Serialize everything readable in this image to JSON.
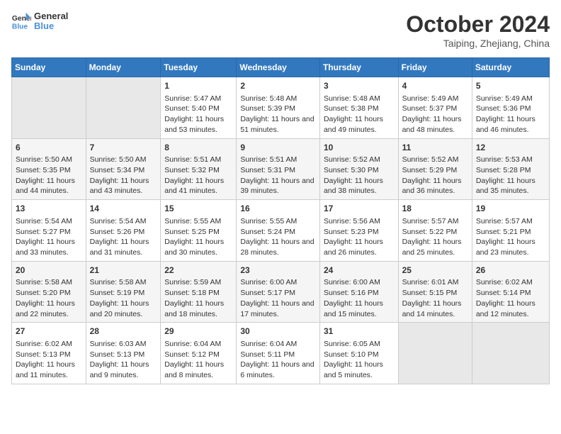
{
  "logo": {
    "line1": "General",
    "line2": "Blue"
  },
  "title": "October 2024",
  "location": "Taiping, Zhejiang, China",
  "days_of_week": [
    "Sunday",
    "Monday",
    "Tuesday",
    "Wednesday",
    "Thursday",
    "Friday",
    "Saturday"
  ],
  "weeks": [
    [
      {
        "day": "",
        "info": ""
      },
      {
        "day": "",
        "info": ""
      },
      {
        "day": "1",
        "info": "Sunrise: 5:47 AM\nSunset: 5:40 PM\nDaylight: 11 hours and 53 minutes."
      },
      {
        "day": "2",
        "info": "Sunrise: 5:48 AM\nSunset: 5:39 PM\nDaylight: 11 hours and 51 minutes."
      },
      {
        "day": "3",
        "info": "Sunrise: 5:48 AM\nSunset: 5:38 PM\nDaylight: 11 hours and 49 minutes."
      },
      {
        "day": "4",
        "info": "Sunrise: 5:49 AM\nSunset: 5:37 PM\nDaylight: 11 hours and 48 minutes."
      },
      {
        "day": "5",
        "info": "Sunrise: 5:49 AM\nSunset: 5:36 PM\nDaylight: 11 hours and 46 minutes."
      }
    ],
    [
      {
        "day": "6",
        "info": "Sunrise: 5:50 AM\nSunset: 5:35 PM\nDaylight: 11 hours and 44 minutes."
      },
      {
        "day": "7",
        "info": "Sunrise: 5:50 AM\nSunset: 5:34 PM\nDaylight: 11 hours and 43 minutes."
      },
      {
        "day": "8",
        "info": "Sunrise: 5:51 AM\nSunset: 5:32 PM\nDaylight: 11 hours and 41 minutes."
      },
      {
        "day": "9",
        "info": "Sunrise: 5:51 AM\nSunset: 5:31 PM\nDaylight: 11 hours and 39 minutes."
      },
      {
        "day": "10",
        "info": "Sunrise: 5:52 AM\nSunset: 5:30 PM\nDaylight: 11 hours and 38 minutes."
      },
      {
        "day": "11",
        "info": "Sunrise: 5:52 AM\nSunset: 5:29 PM\nDaylight: 11 hours and 36 minutes."
      },
      {
        "day": "12",
        "info": "Sunrise: 5:53 AM\nSunset: 5:28 PM\nDaylight: 11 hours and 35 minutes."
      }
    ],
    [
      {
        "day": "13",
        "info": "Sunrise: 5:54 AM\nSunset: 5:27 PM\nDaylight: 11 hours and 33 minutes."
      },
      {
        "day": "14",
        "info": "Sunrise: 5:54 AM\nSunset: 5:26 PM\nDaylight: 11 hours and 31 minutes."
      },
      {
        "day": "15",
        "info": "Sunrise: 5:55 AM\nSunset: 5:25 PM\nDaylight: 11 hours and 30 minutes."
      },
      {
        "day": "16",
        "info": "Sunrise: 5:55 AM\nSunset: 5:24 PM\nDaylight: 11 hours and 28 minutes."
      },
      {
        "day": "17",
        "info": "Sunrise: 5:56 AM\nSunset: 5:23 PM\nDaylight: 11 hours and 26 minutes."
      },
      {
        "day": "18",
        "info": "Sunrise: 5:57 AM\nSunset: 5:22 PM\nDaylight: 11 hours and 25 minutes."
      },
      {
        "day": "19",
        "info": "Sunrise: 5:57 AM\nSunset: 5:21 PM\nDaylight: 11 hours and 23 minutes."
      }
    ],
    [
      {
        "day": "20",
        "info": "Sunrise: 5:58 AM\nSunset: 5:20 PM\nDaylight: 11 hours and 22 minutes."
      },
      {
        "day": "21",
        "info": "Sunrise: 5:58 AM\nSunset: 5:19 PM\nDaylight: 11 hours and 20 minutes."
      },
      {
        "day": "22",
        "info": "Sunrise: 5:59 AM\nSunset: 5:18 PM\nDaylight: 11 hours and 18 minutes."
      },
      {
        "day": "23",
        "info": "Sunrise: 6:00 AM\nSunset: 5:17 PM\nDaylight: 11 hours and 17 minutes."
      },
      {
        "day": "24",
        "info": "Sunrise: 6:00 AM\nSunset: 5:16 PM\nDaylight: 11 hours and 15 minutes."
      },
      {
        "day": "25",
        "info": "Sunrise: 6:01 AM\nSunset: 5:15 PM\nDaylight: 11 hours and 14 minutes."
      },
      {
        "day": "26",
        "info": "Sunrise: 6:02 AM\nSunset: 5:14 PM\nDaylight: 11 hours and 12 minutes."
      }
    ],
    [
      {
        "day": "27",
        "info": "Sunrise: 6:02 AM\nSunset: 5:13 PM\nDaylight: 11 hours and 11 minutes."
      },
      {
        "day": "28",
        "info": "Sunrise: 6:03 AM\nSunset: 5:13 PM\nDaylight: 11 hours and 9 minutes."
      },
      {
        "day": "29",
        "info": "Sunrise: 6:04 AM\nSunset: 5:12 PM\nDaylight: 11 hours and 8 minutes."
      },
      {
        "day": "30",
        "info": "Sunrise: 6:04 AM\nSunset: 5:11 PM\nDaylight: 11 hours and 6 minutes."
      },
      {
        "day": "31",
        "info": "Sunrise: 6:05 AM\nSunset: 5:10 PM\nDaylight: 11 hours and 5 minutes."
      },
      {
        "day": "",
        "info": ""
      },
      {
        "day": "",
        "info": ""
      }
    ]
  ]
}
